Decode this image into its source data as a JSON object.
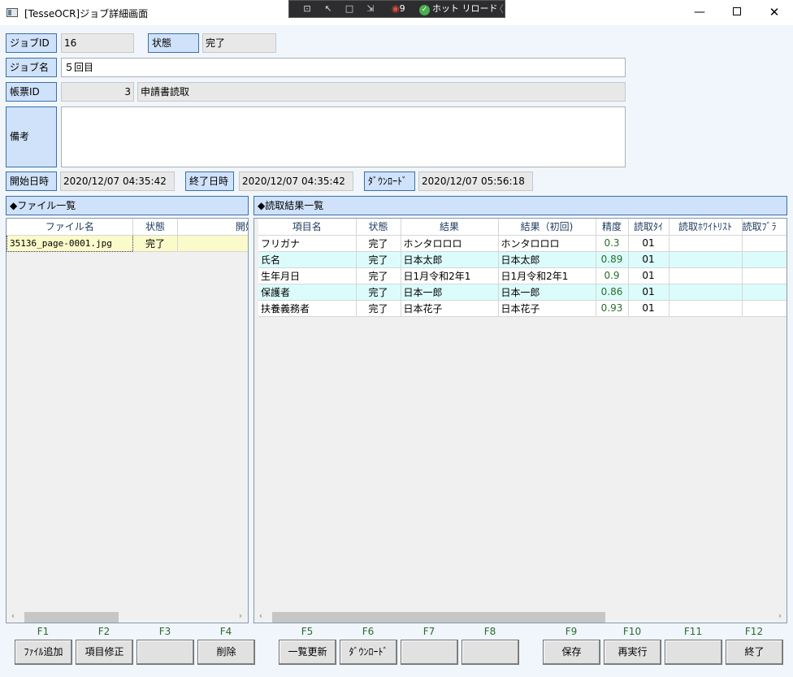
{
  "window": {
    "title": "[TesseOCR]ジョブ詳細画面",
    "minimize": "—",
    "close": "✕"
  },
  "debug_toolbar": {
    "counter": "9",
    "hot_reload": "ホット リロード",
    "collapse": "〈"
  },
  "form": {
    "job_id_label": "ジョブID",
    "job_id": "16",
    "status_label": "状態",
    "status": "完了",
    "job_name_label": "ジョブ名",
    "job_name": "５回目",
    "form_id_label": "帳票ID",
    "form_id": "3",
    "form_name": "申請書読取",
    "remarks_label": "備考",
    "remarks": "",
    "start_label": "開始日時",
    "start": "2020/12/07 04:35:42",
    "end_label": "終了日時",
    "end": "2020/12/07 04:35:42",
    "download_label": "ﾀﾞｳﾝﾛｰﾄﾞ",
    "download": "2020/12/07 05:56:18"
  },
  "file_list": {
    "title": "◆ファイル一覧",
    "columns": [
      "ファイル名",
      "状態",
      "開始日時"
    ],
    "rows": [
      {
        "name": "35136_page-0001.jpg",
        "status": "完了",
        "start": ""
      }
    ],
    "scroll_left": "‹",
    "scroll_right": "›"
  },
  "results": {
    "title": "◆読取結果一覧",
    "columns": [
      "項目名",
      "状態",
      "結果",
      "結果（初回)",
      "精度",
      "読取ﾀｲ",
      "読取ﾎﾜｲﾄﾘｽﾄ",
      "読取ﾌﾞﾗ"
    ],
    "rows": [
      {
        "item": "フリガナ",
        "status": "完了",
        "result": "ホンタロロロ",
        "first": "ホンタロロロ",
        "accuracy": "0.3",
        "type": "01",
        "white": "",
        "black": ""
      },
      {
        "item": "氏名",
        "status": "完了",
        "result": "日本太郎",
        "first": "日本太郎",
        "accuracy": "0.89",
        "type": "01",
        "white": "",
        "black": ""
      },
      {
        "item": "生年月日",
        "status": "完了",
        "result": "日1月令和2年1",
        "first": "日1月令和2年1",
        "accuracy": "0.9",
        "type": "01",
        "white": "",
        "black": ""
      },
      {
        "item": "保護者",
        "status": "完了",
        "result": "日本一郎",
        "first": "日本一郎",
        "accuracy": "0.86",
        "type": "01",
        "white": "",
        "black": ""
      },
      {
        "item": "扶養義務者",
        "status": "完了",
        "result": "日本花子",
        "first": "日本花子",
        "accuracy": "0.93",
        "type": "01",
        "white": "",
        "black": ""
      }
    ],
    "scroll_left": "‹",
    "scroll_right": "›"
  },
  "function_keys": [
    {
      "key": "F1",
      "label": "ﾌｧｲﾙ追加"
    },
    {
      "key": "F2",
      "label": "項目修正"
    },
    {
      "key": "F3",
      "label": ""
    },
    {
      "key": "F4",
      "label": "削除"
    },
    {
      "key": "F5",
      "label": "一覧更新"
    },
    {
      "key": "F6",
      "label": "ﾀﾞｳﾝﾛｰﾄﾞ"
    },
    {
      "key": "F7",
      "label": ""
    },
    {
      "key": "F8",
      "label": ""
    },
    {
      "key": "F9",
      "label": "保存"
    },
    {
      "key": "F10",
      "label": "再実行"
    },
    {
      "key": "F11",
      "label": ""
    },
    {
      "key": "F12",
      "label": "終了"
    }
  ]
}
